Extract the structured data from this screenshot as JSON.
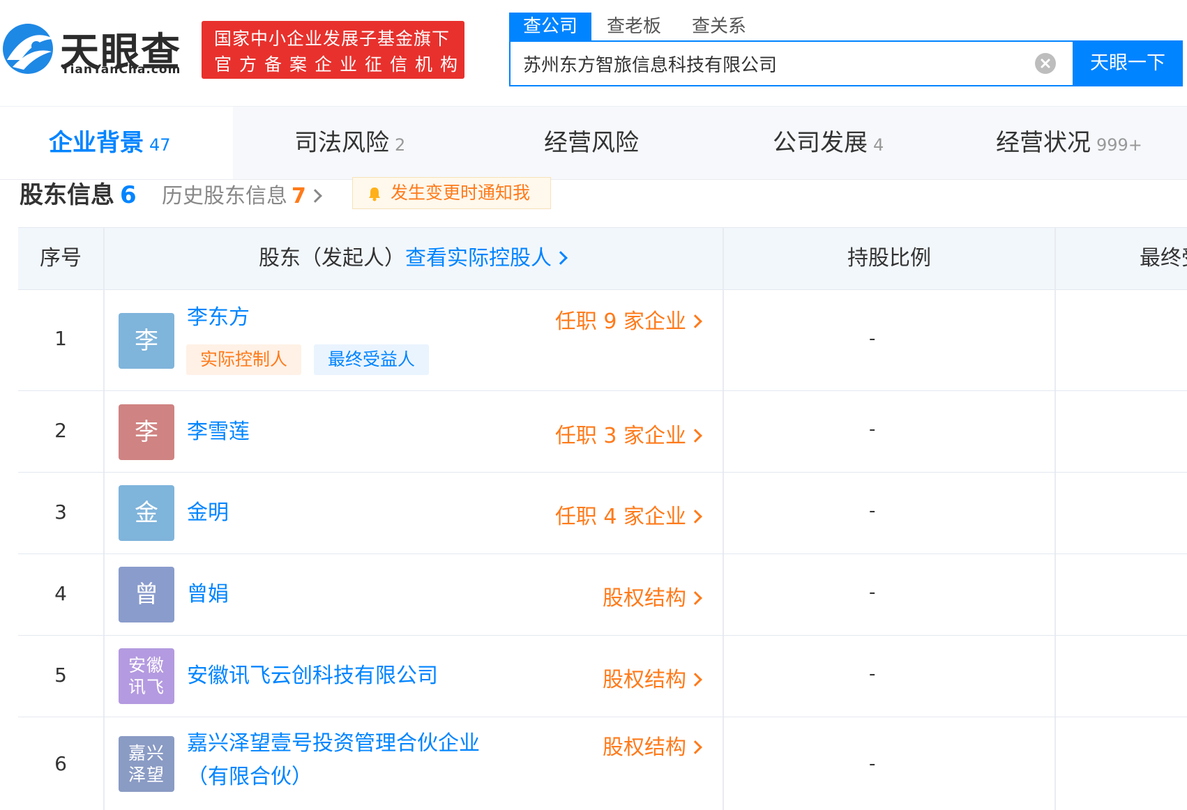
{
  "header": {
    "logo_text": "天眼查",
    "logo_domain": "TianYanCha.com",
    "promo_line1": "国家中小企业发展子基金旗下",
    "promo_line2": "官方备案企业征信机构",
    "search_tabs": [
      "查公司",
      "查老板",
      "查关系"
    ],
    "search_value": "苏州东方智旅信息科技有限公司",
    "search_button": "天眼一下"
  },
  "nav": [
    {
      "label": "企业背景",
      "count": "47"
    },
    {
      "label": "司法风险",
      "count": "2"
    },
    {
      "label": "经营风险",
      "count": ""
    },
    {
      "label": "公司发展",
      "count": "4"
    },
    {
      "label": "经营状况",
      "count": "999+"
    }
  ],
  "section": {
    "title": "股东信息",
    "count": "6",
    "history_label": "历史股东信息",
    "history_count": "7",
    "notify_label": "发生变更时通知我"
  },
  "table": {
    "headers": {
      "index": "序号",
      "shareholder": "股东（发起人）",
      "controller_link": "查看实际控股人",
      "ratio": "持股比例",
      "last": "最终受"
    },
    "rows": [
      {
        "index": "1",
        "avatar": "李",
        "name": "李东方",
        "action": "任职 9 家企业",
        "tag1": "实际控制人",
        "tag2": "最终受益人",
        "ratio": "-"
      },
      {
        "index": "2",
        "avatar": "李",
        "name": "李雪莲",
        "action": "任职 3 家企业",
        "ratio": "-"
      },
      {
        "index": "3",
        "avatar": "金",
        "name": "金明",
        "action": "任职 4 家企业",
        "ratio": "-"
      },
      {
        "index": "4",
        "avatar": "曾",
        "name": "曾娟",
        "action": "股权结构",
        "ratio": "-"
      },
      {
        "index": "5",
        "avatar_l1": "安徽",
        "avatar_l2": "讯飞",
        "name": "安徽讯飞云创科技有限公司",
        "action": "股权结构",
        "ratio": "-"
      },
      {
        "index": "6",
        "avatar_l1": "嘉兴",
        "avatar_l2": "泽望",
        "name": "嘉兴泽望壹号投资管理合伙企业",
        "name_l2": "（有限合伙）",
        "action": "股权结构",
        "ratio": "-"
      }
    ]
  },
  "colors": {
    "brand_blue": "#0084ff",
    "orange": "#ff7a1a",
    "promo_red": "#e8312d",
    "avatar_blue": "#7fb4db",
    "avatar_red": "#cf8382",
    "avatar_slate": "#8a9ccc",
    "avatar_purple": "#b49ae0",
    "avatar_steel": "#8a9bc4"
  }
}
